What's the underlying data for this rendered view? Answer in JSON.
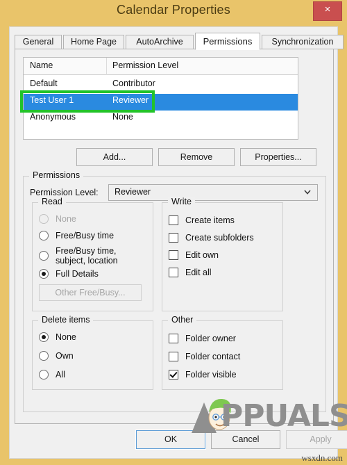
{
  "window": {
    "title": "Calendar Properties",
    "close_label": "×",
    "frame_color": "#e9c46a",
    "close_color": "#c94f4f"
  },
  "tabs": [
    {
      "label": "General",
      "active": false
    },
    {
      "label": "Home Page",
      "active": false
    },
    {
      "label": "AutoArchive",
      "active": false
    },
    {
      "label": "Permissions",
      "active": true
    },
    {
      "label": "Synchronization",
      "active": false
    }
  ],
  "permission_list": {
    "columns": [
      "Name",
      "Permission Level"
    ],
    "rows": [
      {
        "name": "Default",
        "level": "Contributor",
        "selected": false
      },
      {
        "name": "Test User 1",
        "level": "Reviewer",
        "selected": true
      },
      {
        "name": "Anonymous",
        "level": "None",
        "selected": false
      }
    ],
    "selection_color": "#2a8ae0",
    "annotation_color": "#22c32a"
  },
  "list_buttons": {
    "add": "Add...",
    "remove": "Remove",
    "properties": "Properties..."
  },
  "permissions_group": {
    "legend": "Permissions",
    "level_label": "Permission Level:",
    "level_value": "Reviewer"
  },
  "read_group": {
    "legend": "Read",
    "options": [
      {
        "label": "None",
        "checked": false,
        "disabled": true
      },
      {
        "label": "Free/Busy time",
        "checked": false,
        "disabled": false
      },
      {
        "label": "Free/Busy time, subject, location",
        "checked": false,
        "disabled": false
      },
      {
        "label": "Full Details",
        "checked": true,
        "disabled": false
      }
    ],
    "other_freebusy_button": "Other Free/Busy..."
  },
  "write_group": {
    "legend": "Write",
    "options": [
      {
        "label": "Create items",
        "checked": false
      },
      {
        "label": "Create subfolders",
        "checked": false
      },
      {
        "label": "Edit own",
        "checked": false
      },
      {
        "label": "Edit all",
        "checked": false
      }
    ]
  },
  "delete_group": {
    "legend": "Delete items",
    "options": [
      {
        "label": "None",
        "checked": true
      },
      {
        "label": "Own",
        "checked": false
      },
      {
        "label": "All",
        "checked": false
      }
    ]
  },
  "other_group": {
    "legend": "Other",
    "options": [
      {
        "label": "Folder owner",
        "checked": false
      },
      {
        "label": "Folder contact",
        "checked": false
      },
      {
        "label": "Folder visible",
        "checked": true
      }
    ]
  },
  "dialog_buttons": {
    "ok": "OK",
    "cancel": "Cancel",
    "apply": "Apply"
  },
  "watermarks": {
    "appuals": "PPUALS",
    "wsxdn": "wsxdn.com"
  }
}
